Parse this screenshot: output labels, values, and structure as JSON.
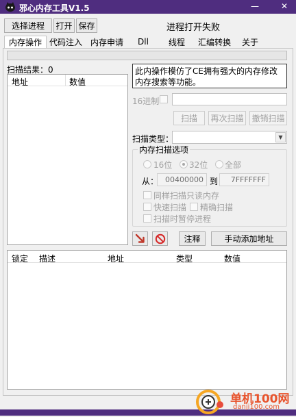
{
  "window": {
    "title": "邪心内存工具V1.5",
    "minimize": "—",
    "close": "✕"
  },
  "toolbar": {
    "select_process": "选择进程",
    "open": "打开",
    "save": "保存",
    "status": "进程打开失败"
  },
  "tabs": [
    {
      "label": "内存操作",
      "active": true
    },
    {
      "label": "代码注入"
    },
    {
      "label": "内存申请"
    },
    {
      "label": "Dll"
    },
    {
      "label": "线程"
    },
    {
      "label": "汇编转换"
    },
    {
      "label": "关于"
    }
  ],
  "scan_results": {
    "label": "扫描结果：0",
    "col_address": "地址",
    "col_value": "数值"
  },
  "info": "此内操作模仿了CE拥有强大的内存修改内存搜索等功能。",
  "hex": {
    "label": "16进制"
  },
  "buttons": {
    "scan": "扫描",
    "rescan": "再次扫描",
    "cancel_scan": "撤销扫描"
  },
  "scan_type": {
    "label": "扫描类型："
  },
  "mem_options": {
    "title": "内存扫描选项",
    "r16": "16位",
    "r32": "32位",
    "rall": "全部",
    "from_label": "从：",
    "from_value": "00400000",
    "to_label": "到",
    "to_value": "7FFFFFFF",
    "opt_readonly": "同样扫描只读内存",
    "opt_fast": "快速扫描",
    "opt_precise": "精确扫描",
    "opt_pause": "扫描时暂停进程"
  },
  "actions": {
    "note": "注释",
    "add_address": "手动添加地址"
  },
  "address_table": {
    "col_lock": "锁定",
    "col_desc": "描述",
    "col_addr": "地址",
    "col_type": "类型",
    "col_value": "数值"
  },
  "watermark": {
    "name": "单机100网",
    "url": "danji100.com"
  }
}
